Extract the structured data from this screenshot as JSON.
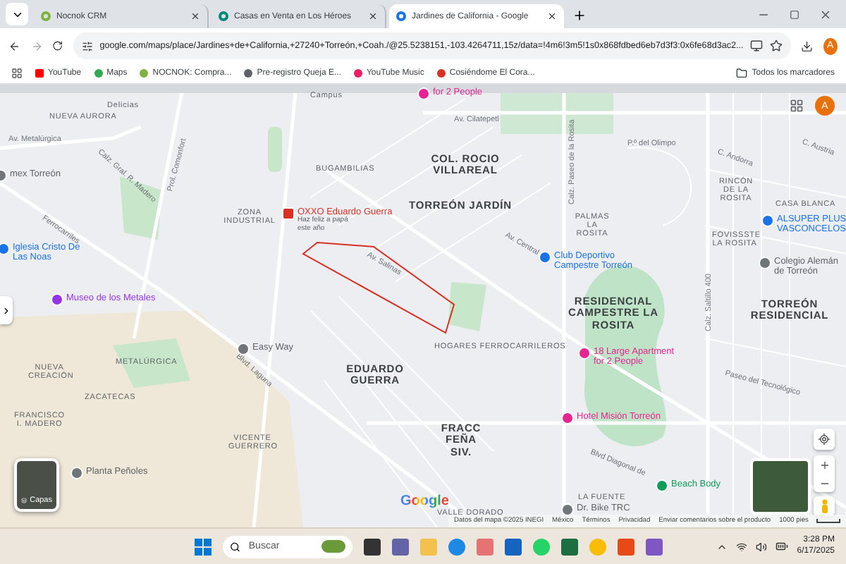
{
  "browser": {
    "tabs": [
      {
        "title": "Nocnok CRM",
        "selected": false
      },
      {
        "title": "Casas en Venta en Los Héroes",
        "selected": false
      },
      {
        "title": "Jardines de California - Google",
        "selected": true
      }
    ],
    "url": "google.com/maps/place/Jardines+de+California,+27240+Torreón,+Coah./@25.5238151,-103.4264711,15z/data=!4m6!3m5!1s0x868fdbed6eb7d3f3:0x6fe68d3ac2...",
    "profile_initial": "A",
    "bookmarks": [
      {
        "label": "YouTube"
      },
      {
        "label": "Maps"
      },
      {
        "label": "NOCNOK: Compra..."
      },
      {
        "label": "Pre-registro Queja E..."
      },
      {
        "label": "YouTube Music"
      },
      {
        "label": "Cosiéndome El Cora..."
      }
    ],
    "all_bookmarks": "Todos los marcadores"
  },
  "map": {
    "areas": [
      {
        "text": "Delicias",
        "kind": "colonia"
      },
      {
        "text": "NUEVA AURORA",
        "kind": "colonia"
      },
      {
        "text": "BUGAMBILIAS",
        "kind": "colonia"
      },
      {
        "text": "ZONA INDUSTRIAL",
        "kind": "colonia"
      },
      {
        "text": "COL. ROCIO VILLAREAL",
        "kind": "district"
      },
      {
        "text": "TORREÓN JARDÍN",
        "kind": "district"
      },
      {
        "text": "RESIDENCIAL CAMPESTRE LA ROSITA",
        "kind": "district"
      },
      {
        "text": "TORREÓN RESIDENCIAL",
        "kind": "district"
      },
      {
        "text": "EDUARDO GUERRA",
        "kind": "district"
      },
      {
        "text": "METALÚRGICA",
        "kind": "colonia"
      },
      {
        "text": "NUEVA CREACIÓN",
        "kind": "colonia"
      },
      {
        "text": "ZACATECAS",
        "kind": "colonia"
      },
      {
        "text": "FRANCISCO I. MADERO",
        "kind": "colonia"
      },
      {
        "text": "VICENTE GUERRERO",
        "kind": "colonia"
      },
      {
        "text": "HOGARES FERROCARRILEROS",
        "kind": "colonia"
      },
      {
        "text": "FRACC FEÑA SIV.",
        "kind": "district"
      },
      {
        "text": "LA FUENTE",
        "kind": "colonia"
      },
      {
        "text": "VALLE DORADO",
        "kind": "colonia"
      },
      {
        "text": "PALMAS LA ROSITA",
        "kind": "colonia"
      },
      {
        "text": "RINCÓN DE LA ROSITA",
        "kind": "colonia"
      },
      {
        "text": "CASA BLANCA",
        "kind": "colonia"
      },
      {
        "text": "FOVISSSTE LA ROSITA",
        "kind": "colonia"
      },
      {
        "text": "Campus",
        "kind": "colonia"
      }
    ],
    "pois": [
      {
        "text": "OXXO Eduardo Guerra",
        "note": "Haz feliz a papá este año",
        "color": "#d93025"
      },
      {
        "text": "Museo de los Metales",
        "color": "#9334e6"
      },
      {
        "text": "Iglesia Cristo De Las Noas",
        "color": "#1a73e8"
      },
      {
        "text": "Club Deportivo Campestre Torreón",
        "color": "#1a73e8"
      },
      {
        "text": "ALSUPER PLUS VASCONCELOS",
        "color": "#1a73e8"
      },
      {
        "text": "Colegio Alemán de Torreón",
        "color": "#70757a"
      },
      {
        "text": "18 Large Apartment for 2 People",
        "color": "#e52592"
      },
      {
        "text": "Hotel Misión Torreón",
        "color": "#e52592"
      },
      {
        "text": "Beach Body",
        "color": "#0f9d58"
      },
      {
        "text": "Dr. Bike TRC",
        "color": "#70757a"
      },
      {
        "text": "Easy Way",
        "color": "#70757a"
      },
      {
        "text": "Planta Peñoles",
        "color": "#70757a"
      },
      {
        "text": "mex Torreón",
        "color": "#70757a"
      },
      {
        "text": "for 2 People",
        "color": "#e52592"
      }
    ],
    "streets": [
      {
        "text": "Calz. Gral. R. Madero"
      },
      {
        "text": "Prol. Comonfort"
      },
      {
        "text": "Av. Metalúrgica"
      },
      {
        "text": "Ferrocarriles"
      },
      {
        "text": "Av. Central"
      },
      {
        "text": "Calz. Paseo de la Rosita"
      },
      {
        "text": "Blvd. Laguna"
      },
      {
        "text": "Calz. Saltillo 400"
      },
      {
        "text": "Av. Cilatepetl"
      },
      {
        "text": "Paseo del Tecnológico"
      },
      {
        "text": "Av. Salinas"
      },
      {
        "text": "P.º del Olimpo"
      },
      {
        "text": "C. Austria"
      },
      {
        "text": "C. Andorra"
      },
      {
        "text": "Blvd Diagonal de"
      }
    ],
    "layers_label": "Capas",
    "account_initial": "A",
    "google_logo": "Google",
    "attribution": [
      "Datos del mapa ©2025 INEGI",
      "México",
      "Términos",
      "Privacidad",
      "Enviar comentarios sobre el producto",
      "1000 pies"
    ]
  },
  "taskbar": {
    "search_placeholder": "Buscar",
    "time": "3:28 PM",
    "date": "6/17/2025"
  }
}
